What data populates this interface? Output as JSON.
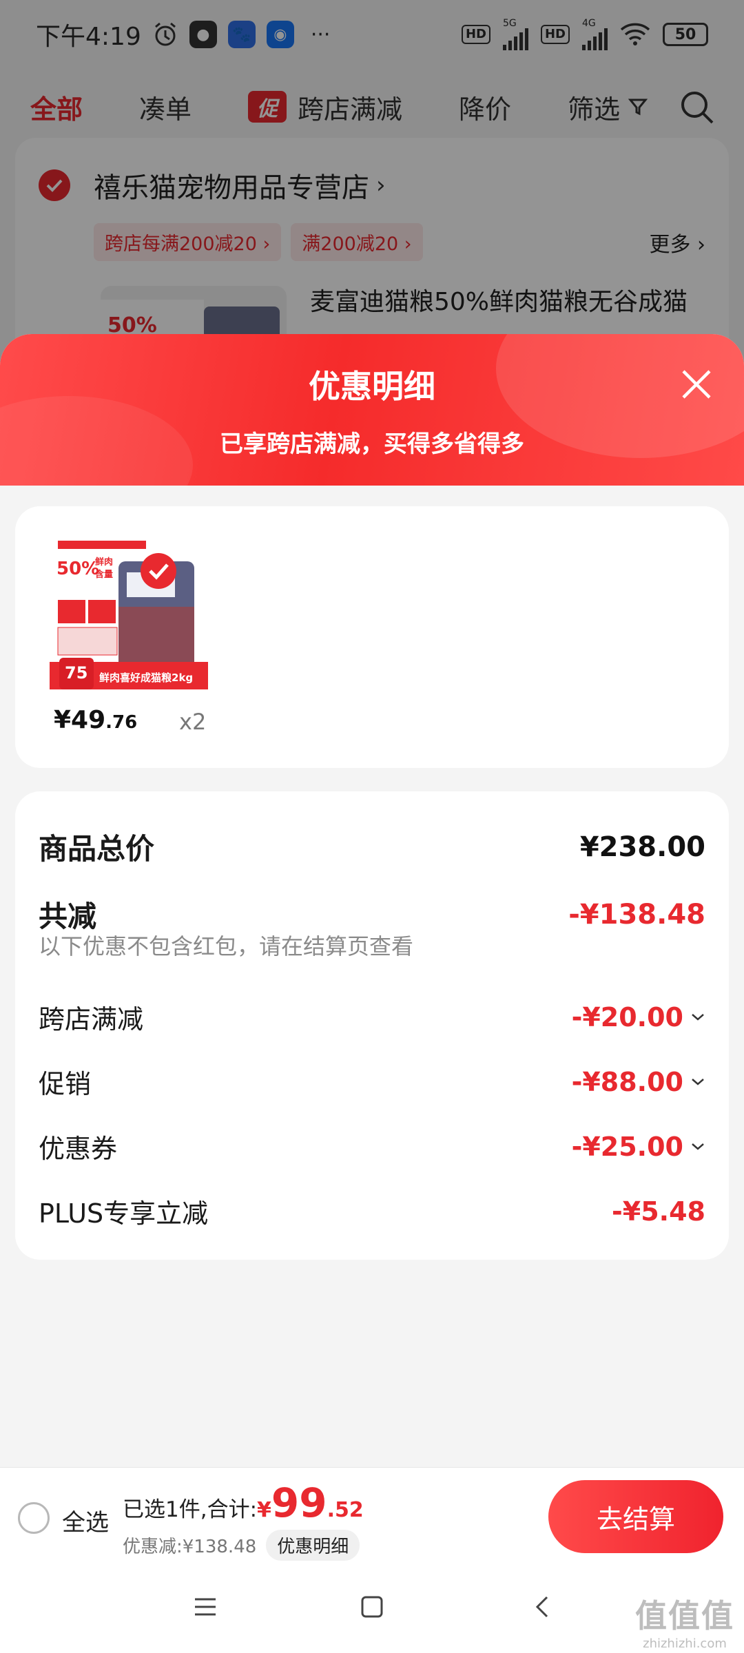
{
  "status_bar": {
    "time": "下午4:19",
    "hd1": "HD",
    "net1": "5G",
    "hd2": "HD",
    "net2": "4G",
    "battery": "50",
    "more": "···"
  },
  "top_nav": {
    "tabs": [
      {
        "label": "全部",
        "active": true
      },
      {
        "label": "凑单"
      },
      {
        "label": "跨店满减",
        "badge": "促"
      },
      {
        "label": "降价"
      },
      {
        "label": "筛选"
      }
    ]
  },
  "shop": {
    "name": "禧乐猫宠物用品专营店",
    "tags": [
      "跨店每满200减20",
      "满200减20"
    ],
    "more": "更多",
    "product_title": "麦富迪猫粮50%鲜肉猫粮无谷成猫"
  },
  "sheet": {
    "title": "优惠明细",
    "subtitle": "已享跨店满减，买得多省得多",
    "product": {
      "price_int": "¥49",
      "price_dec": ".76",
      "qty": "x2",
      "thumb_percent": "50%",
      "thumb_text_1": "鲜肉",
      "thumb_text_2": "含量",
      "thumb_price": "75",
      "thumb_banner": "鲜肉喜好成猫粮2kg"
    },
    "details": {
      "total_label": "商品总价",
      "total_value": "¥238.00",
      "reduce_label": "共减",
      "reduce_value": "-¥138.48",
      "note": "以下优惠不包含红包，请在结算页查看",
      "items": [
        {
          "label": "跨店满减",
          "value": "-¥20.00",
          "expandable": true
        },
        {
          "label": "促销",
          "value": "-¥88.00",
          "expandable": true
        },
        {
          "label": "优惠券",
          "value": "-¥25.00",
          "expandable": true
        },
        {
          "label": "PLUS专享立减",
          "value": "-¥5.48",
          "expandable": false
        }
      ]
    }
  },
  "checkout": {
    "select_all": "全选",
    "selected_text": "已选1件,合计:",
    "currency": "¥",
    "total_int": "99",
    "total_dec": ".52",
    "discount_text": "优惠减:¥138.48",
    "detail_link": "优惠明细",
    "button": "去结算"
  },
  "watermark": {
    "main": "值值值",
    "sub": "zhizhizhi.com"
  },
  "colors": {
    "accent": "#e8292f",
    "overlay": "rgba(0,0,0,0.42)"
  }
}
